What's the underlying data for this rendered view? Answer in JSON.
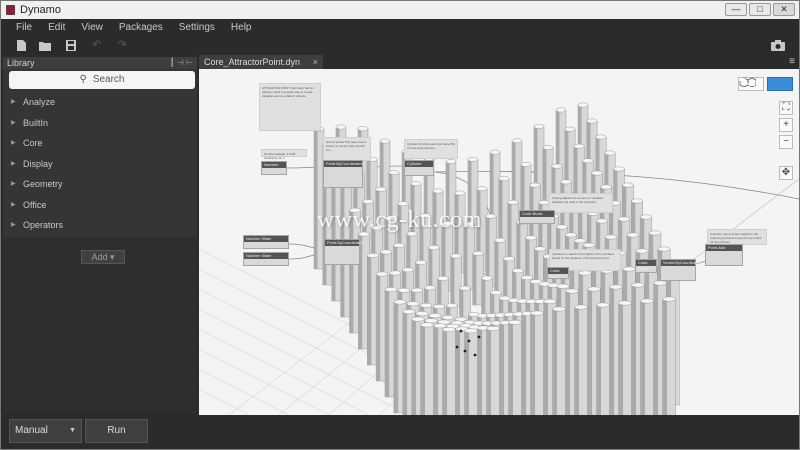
{
  "window": {
    "title": "Dynamo",
    "controls": [
      "—",
      "□",
      "✕"
    ]
  },
  "menu": [
    "File",
    "Edit",
    "View",
    "Packages",
    "Settings",
    "Help"
  ],
  "library": {
    "title": "Library",
    "search_placeholder": "Search",
    "categories": [
      "Analyze",
      "BuiltIn",
      "Core",
      "Display",
      "Geometry",
      "Office",
      "Operators"
    ],
    "add_label": "Add"
  },
  "tab": {
    "label": "Core_AttractorPoint.dyn",
    "close": "×"
  },
  "canvas": {
    "nodes": {
      "number_top": "Number",
      "point_by_coord_1": "Point.ByCoordinates",
      "cylinder": "Cylinder",
      "number_slider_1": "Number Slider",
      "number_slider_2": "Number Slider",
      "point_by_coord_2": "Point.ByCoordinates",
      "code_block_1": "Code Block",
      "code_block_2": "Code Block",
      "code_block_3": "Code Block",
      "vector_by_coord": "Vector.ByCoordinates",
      "point_add": "Point.Add"
    },
    "notes": {
      "title_note": "ATTRACTOR POINT\nSummary: lab\nAn attractor point is a quick way to create variation across a field of objects.",
      "number_note": "Number labeled '1.5-25' displaying as 'n'",
      "grid_note": "Grid of points\nThis step uses a series of number lists of point ins...",
      "cylinder_note": "Cylinder first this uses the Vector.By of rows and columns...",
      "code_note": "Cutting adjusts the amount of variation between the radii of the cylinders.",
      "vector_note": "Cylinders is selects the heights of the cylinders based on the distance of the attractor point.",
      "point_note": "And then use a vector heights to the original grid points to get the top points for the cylinder."
    }
  },
  "navigation": {
    "view_3d_icon": "cube-icon",
    "view_graph_icon": "graph-icon"
  },
  "zoom": {
    "fit": "⛶",
    "in": "+",
    "out": "−",
    "pan": "✥"
  },
  "watermark": "www.cg-ku.com",
  "run": {
    "mode": "Manual",
    "button": "Run"
  },
  "colors": {
    "canvas_bg": "#f4f4f4",
    "ui_dark": "#2b2b2b",
    "panel": "#353535",
    "accent": "#3a8ed8"
  }
}
